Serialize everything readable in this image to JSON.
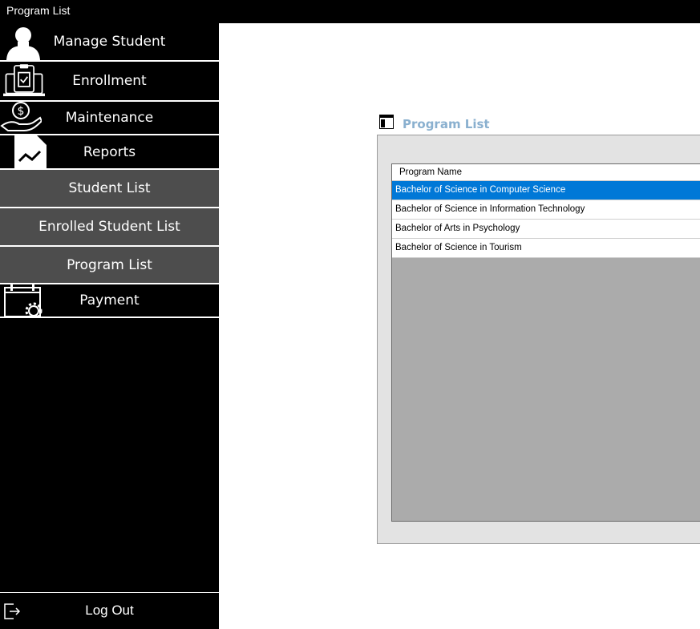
{
  "window": {
    "title": "Program List"
  },
  "sidebar": {
    "items": [
      {
        "label": "Manage Student",
        "icon": "person-icon"
      },
      {
        "label": "Enrollment",
        "icon": "clipboard-laptop-icon"
      },
      {
        "label": "Maintenance",
        "icon": "money-hand-icon"
      },
      {
        "label": "Reports",
        "icon": "report-chart-icon"
      },
      {
        "label": "Student List"
      },
      {
        "label": "Enrolled Student List"
      },
      {
        "label": "Program List"
      },
      {
        "label": "Payment",
        "icon": "calendar-gear-icon"
      }
    ],
    "logout": {
      "label": "Log Out",
      "icon": "logout-icon"
    }
  },
  "main": {
    "panel_title": "Program List",
    "panel_icon": "form-window-icon",
    "grid": {
      "columns": [
        "Program Name"
      ],
      "rows": [
        "Bachelor of Science in Computer Science",
        "Bachelor of Science in Information Technology",
        "Bachelor of Arts in Psychology",
        "Bachelor of Science in Tourism"
      ],
      "selected_index": 0
    }
  },
  "colors": {
    "sidebar_bg": "#000000",
    "submenu_bg": "#4d4d4d",
    "selection": "#0078d7",
    "panel_title": "#8ab0cf"
  }
}
